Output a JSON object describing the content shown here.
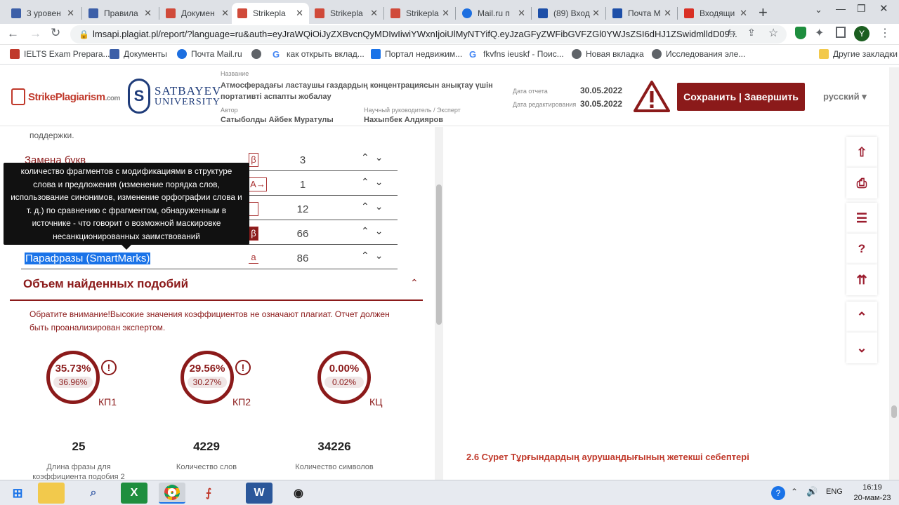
{
  "browser": {
    "tabs": [
      {
        "label": "3 уровен",
        "color": "#3c5fa8"
      },
      {
        "label": "Правила",
        "color": "#3c5fa8"
      },
      {
        "label": "Докумен",
        "color": "#d04a3a"
      },
      {
        "label": "Strikepla",
        "color": "#d04a3a"
      },
      {
        "label": "Strikepla",
        "color": "#d04a3a"
      },
      {
        "label": "Strikepla",
        "color": "#d04a3a"
      },
      {
        "label": "Mail.ru п",
        "color": "#1d6fe0"
      },
      {
        "label": "(89) Вход",
        "color": "#1d4fa8"
      },
      {
        "label": "Почта М",
        "color": "#1d4fa8"
      },
      {
        "label": "Входящи",
        "color": "#d93025"
      }
    ],
    "new_tab": "+",
    "url": "lmsapi.plagiat.pl/report/?language=ru&auth=eyJraWQiOiJyZXBvcnQyMDIwIiwiYWxnIjoiUlMyNTYifQ.eyJzaGFyZWFibGVFZGl0YWJsZSI6dHJ1ZSwidmlldD09...",
    "avatar": "Y",
    "bookmarks": [
      "IELTS Exam Prepara...",
      "Документы",
      "Почта Mail.ru",
      "",
      "как открыть вклад...",
      "Портал недвижим...",
      "fkvfns ieuskf - Поис...",
      "Новая вкладка",
      "Исследования эле..."
    ],
    "other_bookmarks": "Другие закладки"
  },
  "header": {
    "logo_text": "StrikePlagiarism",
    "logo_suffix": ".com",
    "university": "SATBAYEV",
    "university_sub": "UNIVERSITY",
    "title_label": "Название",
    "title": "Атмосферадағы ластаушы газдардың концентрациясын анықтау үшін портативті аспапты жобалау",
    "author_label": "Автор",
    "author": "Сатыболды Айбек Муратулы",
    "supervisor_label": "Научный руководитель / Эксперт",
    "supervisor": "Нахыпбек Алдияров",
    "report_date_label": "Дата отчета",
    "report_date": "30.05.2022",
    "edit_date_label": "Дата редактирования",
    "edit_date": "30.05.2022",
    "save_button": "Сохранить | Завершить",
    "language": "русский"
  },
  "left": {
    "top_text": "поддержки.",
    "rows": [
      {
        "label": "Замена букв",
        "sym": "β",
        "value": "3"
      },
      {
        "label": "",
        "sym": "A→",
        "value": "1"
      },
      {
        "label": "",
        "sym": "",
        "value": "12"
      },
      {
        "label": "",
        "sym": "β",
        "value": "66"
      },
      {
        "label": "Парафразы (SmartMarks)",
        "sym": "a",
        "value": "86"
      }
    ],
    "tooltip": "количество фрагментов с модификациями в структуре слова и предложения (изменение порядка слов, использование синонимов, изменение орфографии слова и т. д.) по сравнению с фрагментом, обнаруженным в источнике - что говорит о возможной маскировке несанкционированных заимствований",
    "section_title": "Объем найденных подобий",
    "notice": "Обратите внимание!Высокие значения коэффициентов не означают плагиат. Отчет должен быть проанализирован экспертом.",
    "coefficients": [
      {
        "main": "35.73%",
        "sub": "36.96%",
        "label": "КП1",
        "warn": "!"
      },
      {
        "main": "29.56%",
        "sub": "30.27%",
        "label": "КП2",
        "warn": "!"
      },
      {
        "main": "0.00%",
        "sub": "0.02%",
        "label": "КЦ",
        "warn": ""
      }
    ],
    "stats": [
      {
        "value": "25",
        "label": "Длина фразы для коэффициента подобия 2"
      },
      {
        "value": "4229",
        "label": "Количество слов"
      },
      {
        "value": "34226",
        "label": "Количество символов"
      }
    ]
  },
  "right": {
    "caption": "2.6 Сурет  Тұрғындардың аурушаңдығының жетекші себептері"
  },
  "taskbar": {
    "lang": "ENG",
    "time": "16:19",
    "date": "20-мам-23"
  }
}
